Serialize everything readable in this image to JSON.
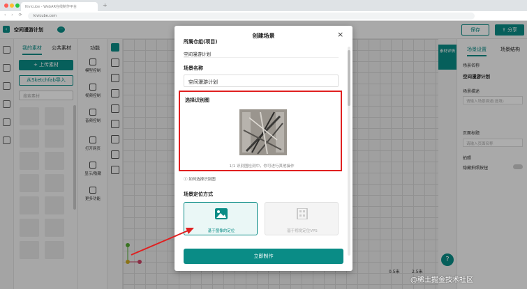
{
  "browser": {
    "tab_title": "Kivicube - WebAR在线制作平台",
    "url": "kivicube.com",
    "nav_arrows": "‹ › ⟳"
  },
  "header": {
    "project_title": "空间漫游计划",
    "back_icon": "arrow-left",
    "save_label": "保存",
    "share_label": "分享"
  },
  "materials": {
    "tabs": [
      "我的素材",
      "公共素材"
    ],
    "upload_label": "+ 上传素材",
    "sketchfab_label": "从Sketchfab导入",
    "search_placeholder": "搜索素材"
  },
  "functions": {
    "title": "功能",
    "items": [
      "模型控制",
      "视频控制",
      "音频控制",
      "打开网页",
      "显示/隐藏",
      "更多功能"
    ]
  },
  "canvas": {
    "scale_labels": [
      "0.5米",
      "2.5米"
    ],
    "help": "?"
  },
  "right_panel": {
    "detail_tab": "素材详情",
    "tabs": [
      "场景设置",
      "场景结构"
    ],
    "scene_name_label": "场景名称",
    "scene_name_value": "空间漫游计划",
    "desc_label": "场景描述",
    "desc_placeholder": "请输入场景描述(选填)",
    "page_title_label": "页面标题",
    "page_title_placeholder": "请输入页面名称",
    "photo_label": "拍照",
    "hide_photo_label": "隐藏拍照按钮"
  },
  "modal": {
    "title": "创建场景",
    "close": "×",
    "repo_label": "所属仓组(项目)",
    "repo_value": "空间漫游计划",
    "scene_name_label": "场景名称",
    "scene_name_value": "空间漫游计划",
    "recog_label": "选择识别图",
    "recog_hint": "1/1 识别图检测中，你可进行其他操作",
    "how_link": "如何选择识别图",
    "mode_label": "场景定位方式",
    "mode_options": [
      {
        "label": "基于图像的定位",
        "selected": true
      },
      {
        "label": "基于视觉定位VPS",
        "selected": false
      }
    ],
    "create_label": "立即制作"
  },
  "watermark": "@稀土掘金技术社区",
  "colors": {
    "accent": "#0a8c86",
    "highlight": "#e02020"
  }
}
